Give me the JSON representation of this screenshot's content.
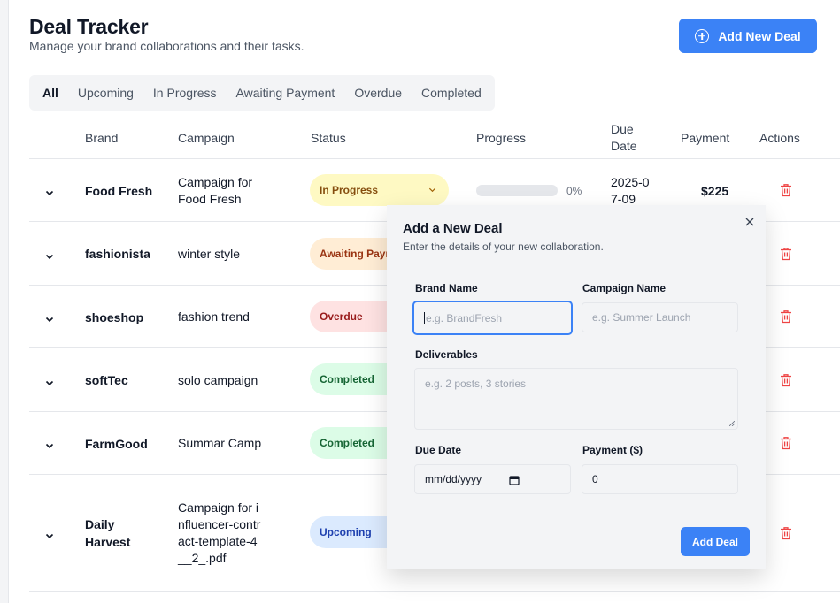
{
  "header": {
    "title": "Deal Tracker",
    "subtitle": "Manage your brand collaborations and their tasks.",
    "add_button_label": "Add New Deal"
  },
  "tabs": [
    {
      "label": "All",
      "active": true
    },
    {
      "label": "Upcoming",
      "active": false
    },
    {
      "label": "In Progress",
      "active": false
    },
    {
      "label": "Awaiting Payment",
      "active": false
    },
    {
      "label": "Overdue",
      "active": false
    },
    {
      "label": "Completed",
      "active": false
    }
  ],
  "table": {
    "columns": [
      "Brand",
      "Campaign",
      "Status",
      "Progress",
      "Due Date",
      "Payment",
      "Actions"
    ],
    "rows": [
      {
        "brand": "Food Fresh",
        "campaign": "Campaign for Food Fresh",
        "status": "In Progress",
        "progress_percent": 0,
        "progress_label": "0%",
        "due_date": "2025-07-09",
        "payment": "$225"
      },
      {
        "brand": "fashionista",
        "campaign": "winter style",
        "status": "Awaiting Payment",
        "status_visible": "Awaiting Payı"
      },
      {
        "brand": "shoeshop",
        "campaign": "fashion trend",
        "status": "Overdue"
      },
      {
        "brand": "softTec",
        "campaign": "solo campaign",
        "status": "Completed"
      },
      {
        "brand": "FarmGood",
        "campaign": "Summar Camp",
        "status": "Completed"
      },
      {
        "brand": "Daily Harvest",
        "campaign": "Campaign for influencer-contract-template-4__2_.pdf",
        "status": "Upcoming"
      }
    ]
  },
  "modal": {
    "title": "Add a New Deal",
    "subtitle": "Enter the details of your new collaboration.",
    "fields": {
      "brand_name": {
        "label": "Brand Name",
        "placeholder": "e.g. BrandFresh"
      },
      "campaign_name": {
        "label": "Campaign Name",
        "placeholder": "e.g. Summer Launch"
      },
      "deliverables": {
        "label": "Deliverables",
        "placeholder": "e.g. 2 posts, 3 stories"
      },
      "due_date": {
        "label": "Due Date",
        "placeholder": "mm/dd/yyyy"
      },
      "payment": {
        "label": "Payment ($)",
        "value": "0"
      }
    },
    "submit_label": "Add Deal"
  },
  "colors": {
    "accent": "#3b82f6",
    "in_progress": "#fef9c3",
    "awaiting": "#ffedd5",
    "overdue": "#fee2e2",
    "completed": "#dcfce7",
    "upcoming": "#dbeafe",
    "danger": "#ef4444"
  }
}
